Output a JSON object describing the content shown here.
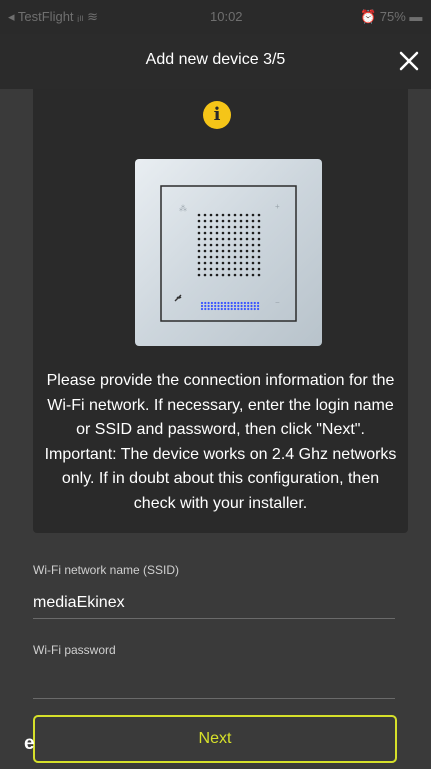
{
  "status_bar": {
    "left": "◂ TestFlight ᵢₗₗ ≋",
    "time": "10:02",
    "right": "⏰ 75% ▬"
  },
  "header": {
    "title": "Add new device 3/5"
  },
  "card": {
    "description": "Please provide the connection information for the Wi-Fi network. If necessary, enter the login name or SSID and password, then click \"Next\". Important: The device works on 2.4 Ghz networks only. If in doubt about this configuration, then check with your installer."
  },
  "form": {
    "ssid_label": "Wi-Fi network name (SSID)",
    "ssid_value": "mediaEkinex",
    "password_label": "Wi-Fi password",
    "password_value": ""
  },
  "next_label": "Next",
  "corner_letter": "e",
  "colors": {
    "accent": "#d6e02a",
    "info": "#f5c518",
    "background": "#3a3a3a"
  }
}
